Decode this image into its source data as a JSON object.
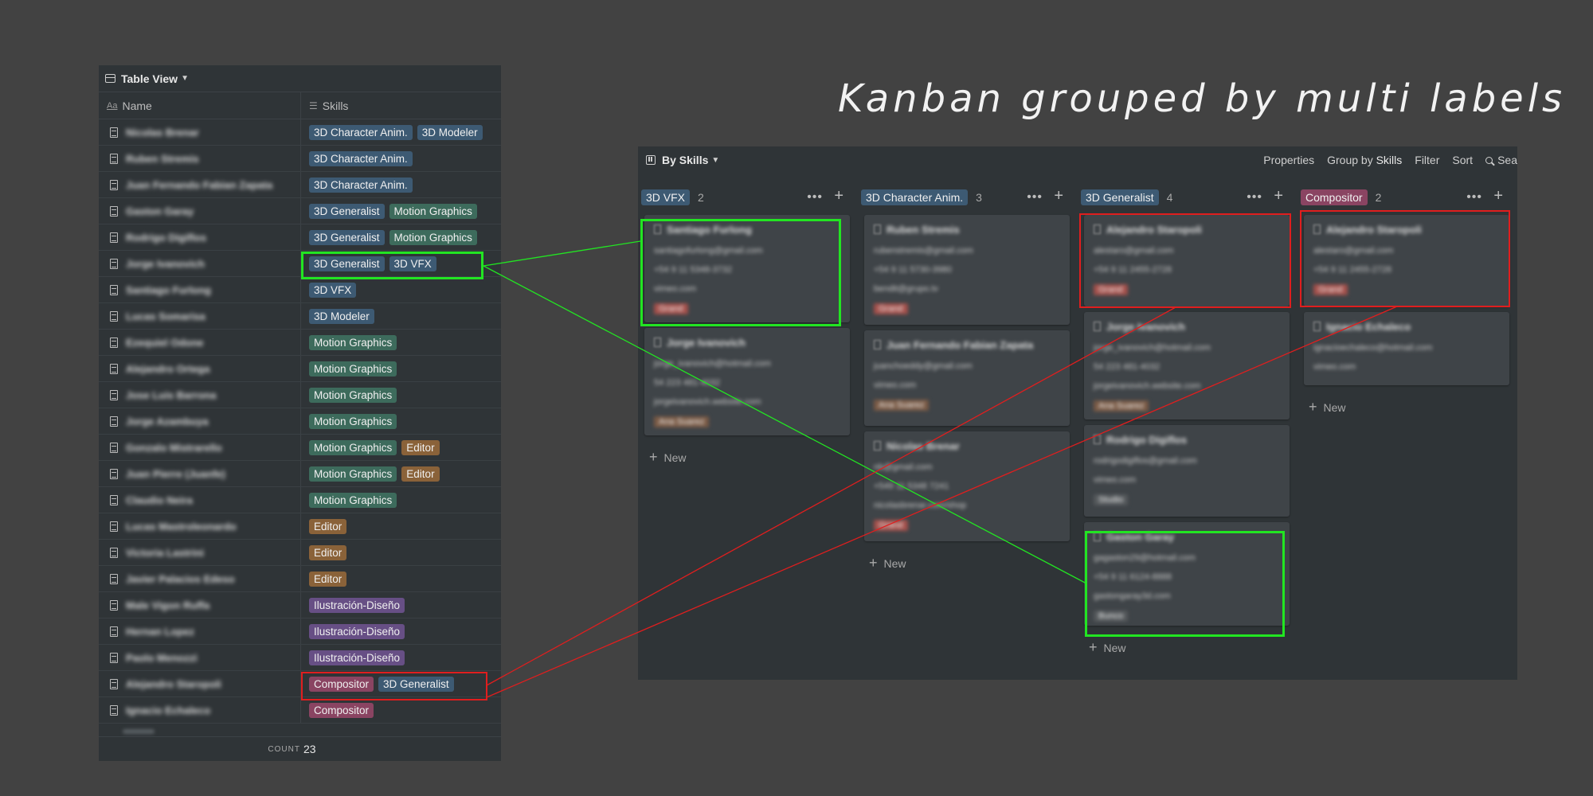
{
  "title": "Kanban grouped by multi labels",
  "colors": {
    "blue": "#3d5a73",
    "green": "#3d6b5c",
    "orange": "#8a6239",
    "purple": "#674f85",
    "pink": "#8a4462",
    "highlight_green": "#22e522",
    "highlight_red": "#e01e1e"
  },
  "table": {
    "view_label": "Table View",
    "col_name": "Name",
    "col_name_icon": "Aa",
    "col_skills": "Skills",
    "footer_label": "COUNT",
    "footer_value": "23",
    "rows": [
      {
        "name": "Nicolas Brenar",
        "skills": [
          {
            "label": "3D Character Anim.",
            "color": "blue"
          },
          {
            "label": "3D Modeler",
            "color": "blue"
          }
        ]
      },
      {
        "name": "Ruben Stremis",
        "skills": [
          {
            "label": "3D Character Anim.",
            "color": "blue"
          }
        ]
      },
      {
        "name": "Juan Fernando Fabian Zapata",
        "skills": [
          {
            "label": "3D Character Anim.",
            "color": "blue"
          }
        ]
      },
      {
        "name": "Gaston Garay",
        "skills": [
          {
            "label": "3D Generalist",
            "color": "blue"
          },
          {
            "label": "Motion Graphics",
            "color": "green"
          }
        ]
      },
      {
        "name": "Rodrigo Digiflos",
        "skills": [
          {
            "label": "3D Generalist",
            "color": "blue"
          },
          {
            "label": "Motion Graphics",
            "color": "green"
          }
        ]
      },
      {
        "name": "Jorge Ivanovich",
        "skills": [
          {
            "label": "3D Generalist",
            "color": "blue"
          },
          {
            "label": "3D VFX",
            "color": "blue"
          }
        ]
      },
      {
        "name": "Santiago Furlong",
        "skills": [
          {
            "label": "3D VFX",
            "color": "blue"
          }
        ]
      },
      {
        "name": "Lucas Somarisa",
        "skills": [
          {
            "label": "3D Modeler",
            "color": "blue"
          }
        ]
      },
      {
        "name": "Ezequiel Odone",
        "skills": [
          {
            "label": "Motion Graphics",
            "color": "green"
          }
        ]
      },
      {
        "name": "Alejandro Ortega",
        "skills": [
          {
            "label": "Motion Graphics",
            "color": "green"
          }
        ]
      },
      {
        "name": "Jose Luis Barrona",
        "skills": [
          {
            "label": "Motion Graphics",
            "color": "green"
          }
        ]
      },
      {
        "name": "Jorge Azambuya",
        "skills": [
          {
            "label": "Motion Graphics",
            "color": "green"
          }
        ]
      },
      {
        "name": "Gonzalo Mistrarello",
        "skills": [
          {
            "label": "Motion Graphics",
            "color": "green"
          },
          {
            "label": "Editor",
            "color": "orange"
          }
        ]
      },
      {
        "name": "Juan Pierre (Juanfe)",
        "skills": [
          {
            "label": "Motion Graphics",
            "color": "green"
          },
          {
            "label": "Editor",
            "color": "orange"
          }
        ]
      },
      {
        "name": "Claudio Neira",
        "skills": [
          {
            "label": "Motion Graphics",
            "color": "green"
          }
        ]
      },
      {
        "name": "Lucas Mastroleonardo",
        "skills": [
          {
            "label": "Editor",
            "color": "orange"
          }
        ]
      },
      {
        "name": "Victoria Lastrini",
        "skills": [
          {
            "label": "Editor",
            "color": "orange"
          }
        ]
      },
      {
        "name": "Javier Palacios Edeso",
        "skills": [
          {
            "label": "Editor",
            "color": "orange"
          }
        ]
      },
      {
        "name": "Male Vigon Ruffa",
        "skills": [
          {
            "label": "Ilustración-Diseño",
            "color": "purple"
          }
        ]
      },
      {
        "name": "Hernan Lopez",
        "skills": [
          {
            "label": "Ilustración-Diseño",
            "color": "purple"
          }
        ]
      },
      {
        "name": "Paolo Menozzi",
        "skills": [
          {
            "label": "Ilustración-Diseño",
            "color": "purple"
          }
        ]
      },
      {
        "name": "Alejandro Staropoli",
        "skills": [
          {
            "label": "Compositor",
            "color": "pink"
          },
          {
            "label": "3D Generalist",
            "color": "blue"
          }
        ]
      },
      {
        "name": "Ignacio Echaleco",
        "skills": [
          {
            "label": "Compositor",
            "color": "pink"
          }
        ]
      }
    ]
  },
  "kanban": {
    "view_label": "By Skills",
    "actions": {
      "properties": "Properties",
      "group_by": "Group by",
      "group_by_value": "Skills",
      "filter": "Filter",
      "sort": "Sort",
      "search": "Sea"
    },
    "new_label": "New",
    "columns": [
      {
        "label": "3D VFX",
        "color": "blue",
        "count": "2",
        "cards": [
          {
            "name": "Santiago Furlong",
            "lines": [
              "santiagofurlong@gmail.com",
              "+54 9 11 5348-3732",
              "vimeo.com"
            ],
            "badge": {
              "label": "Grand",
              "color": "#a4504b"
            }
          },
          {
            "name": "Jorge Ivanovich",
            "lines": [
              "jorge_ivanovich@hotmail.com",
              "54 223 481-4032",
              "jorgeivanovich.website.com"
            ],
            "badge": {
              "label": "Ana Suarez",
              "color": "#7a5a45"
            }
          }
        ]
      },
      {
        "label": "3D Character Anim.",
        "color": "blue",
        "count": "3",
        "cards": [
          {
            "name": "Ruben Stremis",
            "lines": [
              "rubenstremis@gmail.com",
              "+54 9 11 5730-3980",
              "bendit@grupo.tv"
            ],
            "badge": {
              "label": "Grand",
              "color": "#a4504b"
            }
          },
          {
            "name": "Juan Fernando Fabian Zapata",
            "lines": [
              "juanchoeddy@gmail.com",
              "vimeo.com"
            ],
            "badge": {
              "label": "Ana Suarez",
              "color": "#7a5a45"
            }
          },
          {
            "name": "Nicolas Brenar",
            "lines": [
              "nb@gmail.com",
              "+549 11 5348 7241",
              "nicolasbrenar.com/shop"
            ],
            "badge": {
              "label": "Grand",
              "color": "#a4504b"
            }
          }
        ]
      },
      {
        "label": "3D Generalist",
        "color": "blue",
        "count": "4",
        "cards": [
          {
            "name": "Alejandro Staropoli",
            "lines": [
              "alestaro@gmail.com",
              "+54 9 11 2455-2728"
            ],
            "badge": {
              "label": "Grand",
              "color": "#a4504b"
            }
          },
          {
            "name": "Jorge Ivanovich",
            "lines": [
              "jorge_ivanovich@hotmail.com",
              "54 223 481-4032",
              "jorgeivanovich.website.com"
            ],
            "badge": {
              "label": "Ana Suarez",
              "color": "#7a5a45"
            }
          },
          {
            "name": "Rodrigo Digiflos",
            "lines": [
              "rodrigodigiflos@gmail.com",
              "vimeo.com"
            ],
            "badge": {
              "label": "Studio",
              "color": "#55595c"
            }
          },
          {
            "name": "Gaston Garay",
            "lines": [
              "gagaston29@hotmail.com",
              "+54 9 11 6124-8888",
              "gastongaray3d.com"
            ],
            "badge": {
              "label": "Bunco",
              "color": "#55595c"
            }
          }
        ]
      },
      {
        "label": "Compositor",
        "color": "pink",
        "count": "2",
        "cards": [
          {
            "name": "Alejandro Staropoli",
            "lines": [
              "alestaro@gmail.com",
              "+54 9 11 2455-2728"
            ],
            "badge": {
              "label": "Grand",
              "color": "#a4504b"
            }
          },
          {
            "name": "Ignacio Echaleco",
            "lines": [
              "ignacioechaleco@hotmail.com",
              "vimeo.com"
            ],
            "badge": null
          }
        ]
      }
    ]
  }
}
